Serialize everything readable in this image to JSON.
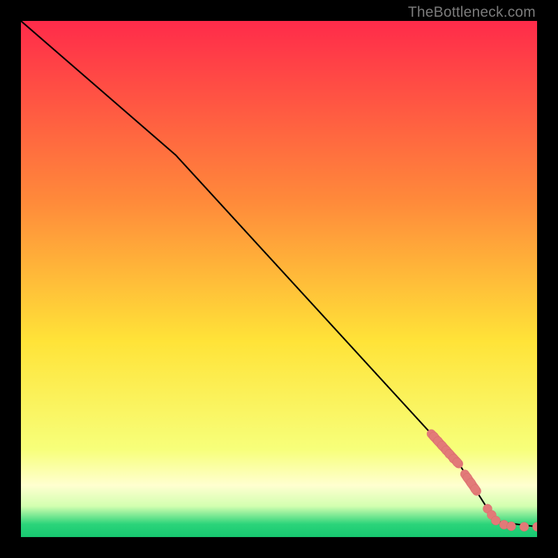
{
  "watermark": "TheBottleneck.com",
  "colors": {
    "black": "#000000",
    "line": "#000000",
    "marker_fill": "#e27a78",
    "marker_stroke": "#d86a68",
    "grad_top": "#ff2b4a",
    "grad_mid1": "#ff8a3a",
    "grad_mid2": "#ffe338",
    "grad_mid3": "#f7ff7a",
    "grad_mid4": "#d3ffb0",
    "grad_bottom": "#2bd47a",
    "grad_bottom2": "#17c870"
  },
  "chart_data": {
    "type": "line",
    "title": "",
    "xlabel": "",
    "ylabel": "",
    "xlim": [
      0,
      100
    ],
    "ylim": [
      0,
      100
    ],
    "grid": false,
    "series": [
      {
        "name": "curve",
        "x": [
          0,
          30,
          85,
          92,
          100
        ],
        "y": [
          100,
          74,
          14,
          3,
          2
        ]
      }
    ],
    "markers": [
      {
        "x": 80.0,
        "y": 19.5
      },
      {
        "x": 80.8,
        "y": 18.6
      },
      {
        "x": 81.6,
        "y": 17.7
      },
      {
        "x": 82.4,
        "y": 16.8
      },
      {
        "x": 83.0,
        "y": 16.1
      },
      {
        "x": 83.8,
        "y": 15.2
      },
      {
        "x": 84.5,
        "y": 14.5
      },
      {
        "x": 86.5,
        "y": 11.5
      },
      {
        "x": 87.2,
        "y": 10.5
      },
      {
        "x": 88.0,
        "y": 9.3
      },
      {
        "x": 90.4,
        "y": 5.5
      },
      {
        "x": 91.2,
        "y": 4.3
      },
      {
        "x": 92.0,
        "y": 3.2
      },
      {
        "x": 93.6,
        "y": 2.4
      },
      {
        "x": 95.0,
        "y": 2.1
      },
      {
        "x": 97.5,
        "y": 2.0
      },
      {
        "x": 100.0,
        "y": 2.0
      }
    ],
    "dense_marker_segments": [
      {
        "x1": 79.5,
        "y1": 20.0,
        "x2": 84.8,
        "y2": 14.2
      },
      {
        "x1": 86.0,
        "y1": 12.2,
        "x2": 88.3,
        "y2": 8.9
      }
    ]
  }
}
